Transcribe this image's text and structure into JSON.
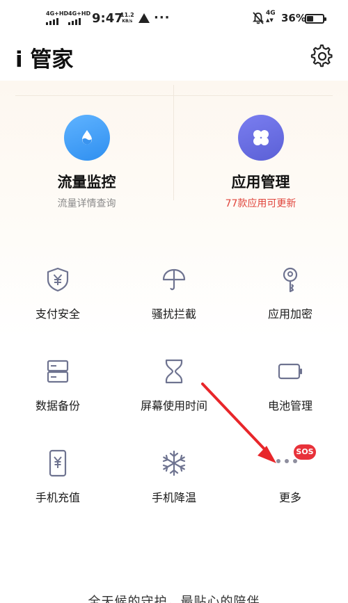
{
  "status_bar": {
    "sim1": "4G+HD",
    "sim2": "4G+HD",
    "time": "9:47",
    "net_speed_value": "11.2",
    "net_speed_unit": "KB/s",
    "dots": "···",
    "network": "4G",
    "battery_percent": "36%",
    "battery_level": 0.36
  },
  "header": {
    "title": "i 管家",
    "settings_icon": "gear-icon"
  },
  "featured": [
    {
      "title": "流量监控",
      "subtitle": "流量详情查询",
      "icon": "water-drop-icon",
      "color": "#3d9bf5"
    },
    {
      "title": "应用管理",
      "subtitle": "77款应用可更新",
      "icon": "app-grid-icon",
      "color": "#676be3",
      "subtitle_color": "#e0443b"
    }
  ],
  "grid": [
    {
      "label": "支付安全",
      "icon": "yuan-shield-icon"
    },
    {
      "label": "骚扰拦截",
      "icon": "umbrella-icon"
    },
    {
      "label": "应用加密",
      "icon": "key-icon"
    },
    {
      "label": "数据备份",
      "icon": "storage-icon"
    },
    {
      "label": "屏幕使用时间",
      "icon": "hourglass-icon"
    },
    {
      "label": "电池管理",
      "icon": "battery-icon"
    },
    {
      "label": "手机充值",
      "icon": "phone-yuan-icon"
    },
    {
      "label": "手机降温",
      "icon": "snowflake-icon"
    },
    {
      "label": "更多",
      "icon": "more-dots-icon"
    }
  ],
  "badge": {
    "text": "SOS",
    "color": "#e8323a"
  },
  "footer": {
    "slogan": "全天候的守护，最贴心的陪伴"
  },
  "colors": {
    "icon_stroke": "#6e7390",
    "annotation_arrow": "#e8262a"
  }
}
